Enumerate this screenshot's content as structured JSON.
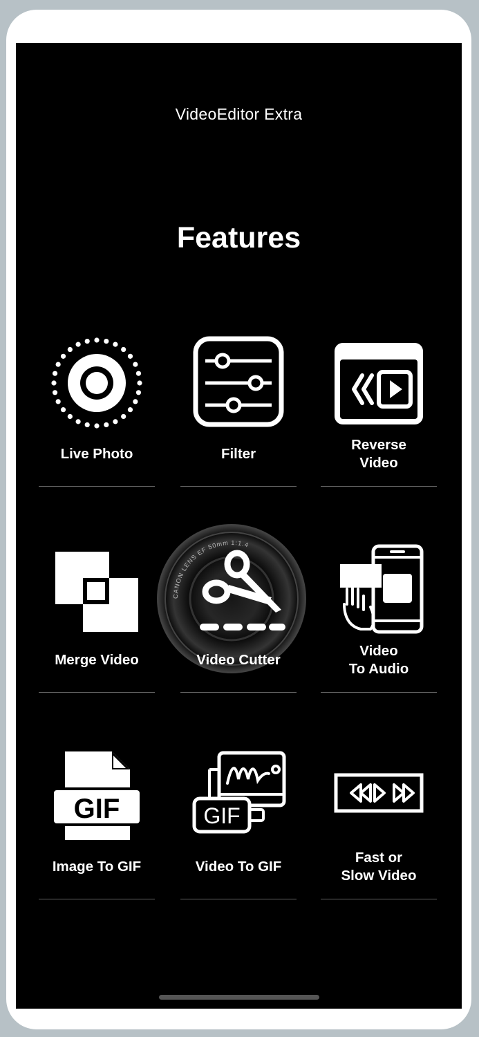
{
  "app": {
    "title": "VideoEditor Extra"
  },
  "section": {
    "title": "Features"
  },
  "features": [
    {
      "label": "Live Photo",
      "icon": "live-photo-icon"
    },
    {
      "label": "Filter",
      "icon": "sliders-icon"
    },
    {
      "label": "Reverse\nVideo",
      "icon": "reverse-video-icon"
    },
    {
      "label": "Merge Video",
      "icon": "merge-squares-icon"
    },
    {
      "label": "Video Cutter",
      "icon": "scissors-icon"
    },
    {
      "label": "Video\nTo Audio",
      "icon": "phone-tap-icon"
    },
    {
      "label": "Image To GIF",
      "icon": "gif-file-icon"
    },
    {
      "label": "Video To GIF",
      "icon": "video-gif-icon"
    },
    {
      "label": "Fast or\nSlow Video",
      "icon": "speed-controls-icon"
    }
  ],
  "lens_text": "CANON LENS EF 50mm 1:1.4"
}
